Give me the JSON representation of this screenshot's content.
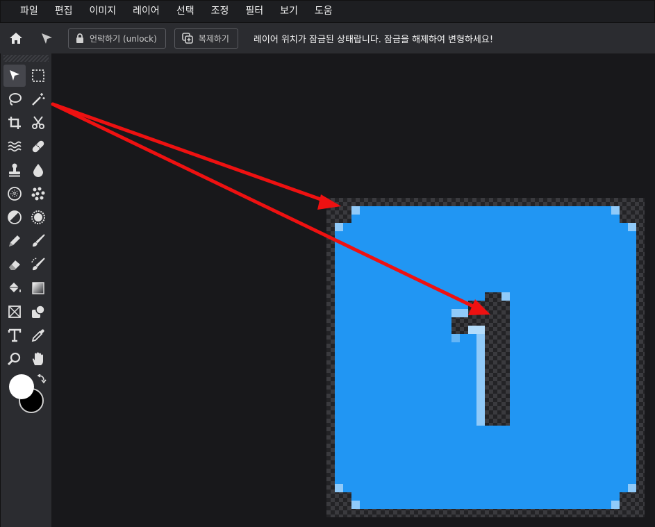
{
  "menubar": {
    "items": [
      "파일",
      "편집",
      "이미지",
      "레이어",
      "선택",
      "조정",
      "필터",
      "보기",
      "도움"
    ]
  },
  "options": {
    "unlock_label": "언락하기 (unlock)",
    "duplicate_label": "복제하기",
    "lock_message": "레이어 위치가 잠금된 상태랍니다. 잠금을 해제하여 변형하세요!"
  },
  "colors": {
    "accent": "#2196f3",
    "arrow": "#ee1111",
    "foreground": "#ffffff",
    "background": "#000000"
  },
  "tools": [
    "move-tool",
    "marquee-tool",
    "lasso-tool",
    "magic-wand-tool",
    "crop-tool",
    "cut-tool",
    "liquify-tool",
    "healing-tool",
    "clone-stamp-tool",
    "blur-tool",
    "sponge-tool",
    "spot-tool",
    "dodge-tool",
    "sharpen-tool",
    "pencil-tool",
    "brush-tool",
    "eraser-tool",
    "color-replace-tool",
    "fill-tool",
    "gradient-tool",
    "frame-tool",
    "shape-tool",
    "text-tool",
    "eyedropper-tool",
    "zoom-tool",
    "hand-tool"
  ],
  "canvas": {
    "image_glyph": "1"
  }
}
